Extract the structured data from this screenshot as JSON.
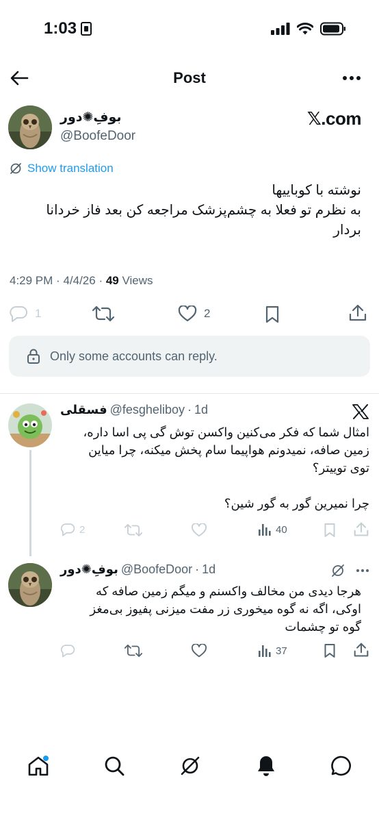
{
  "status_bar": {
    "time": "1:03"
  },
  "header": {
    "title": "Post"
  },
  "post": {
    "author_name": "بوفِ✺دور",
    "author_handle": "@BoofeDoor",
    "source": "𝕏.com",
    "show_translation": "Show translation",
    "text_lines": [
      "نوشته با کوباییها",
      "به نظرم تو فعلا به چشم‌پزشک مراجعه کن بعد فاز خردانا",
      "بردار"
    ],
    "time": "4:29 PM",
    "date": "4/4/26",
    "views_count": "49",
    "views_label": "Views",
    "reply_count": "1",
    "like_count": "2",
    "reply_restriction": "Only some accounts can reply."
  },
  "replies": [
    {
      "name": "فسقلی",
      "handle": "@fesgheliboy",
      "time": "1d",
      "text_lines": [
        "امثال شما که فکر می‌کنین واکسن توش گی پی اسا داره،",
        "زمین صافه، نمیدونم هواپیما سام پخش میکنه، چرا میاین",
        "توی توییتر؟",
        "",
        "چرا نمیرین گور به گور شین؟"
      ],
      "reply_count": "2",
      "views": "40"
    },
    {
      "name": "بوفِ✺دور",
      "handle": "@BoofeDoor",
      "time": "1d",
      "text_lines": [
        "هرجا دیدی من مخالف واکسنم و میگم زمین صافه که",
        "اوکی، اگه نه گوه میخوری زر مفت میزنی پفیوز بی‌مغز",
        "گوه تو چشمات"
      ],
      "views": "37"
    }
  ],
  "colors": {
    "accent": "#1d9bf0",
    "text": "#0f1419",
    "muted": "#536471",
    "reply_box_bg": "#eff3f4",
    "divider": "#e6e9ea"
  },
  "icons": {
    "back": "arrow-left-icon",
    "more": "more-horizontal-icon",
    "translate": "globe-slash-icon",
    "reply": "reply-bubble-icon",
    "retweet": "retweet-icon",
    "like": "heart-icon",
    "bookmark": "bookmark-icon",
    "share": "share-icon",
    "lock": "lock-icon",
    "views": "bar-chart-icon",
    "nav": [
      "home-icon",
      "search-icon",
      "grok-icon",
      "notifications-icon",
      "messages-icon"
    ]
  }
}
